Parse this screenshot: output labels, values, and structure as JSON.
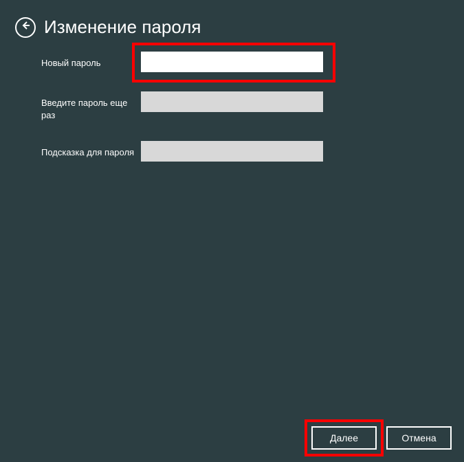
{
  "header": {
    "title": "Изменение пароля"
  },
  "form": {
    "new_password_label": "Новый пароль",
    "confirm_password_label": "Введите пароль еще раз",
    "hint_label": "Подсказка для пароля"
  },
  "footer": {
    "next_label": "Далее",
    "cancel_label": "Отмена"
  }
}
